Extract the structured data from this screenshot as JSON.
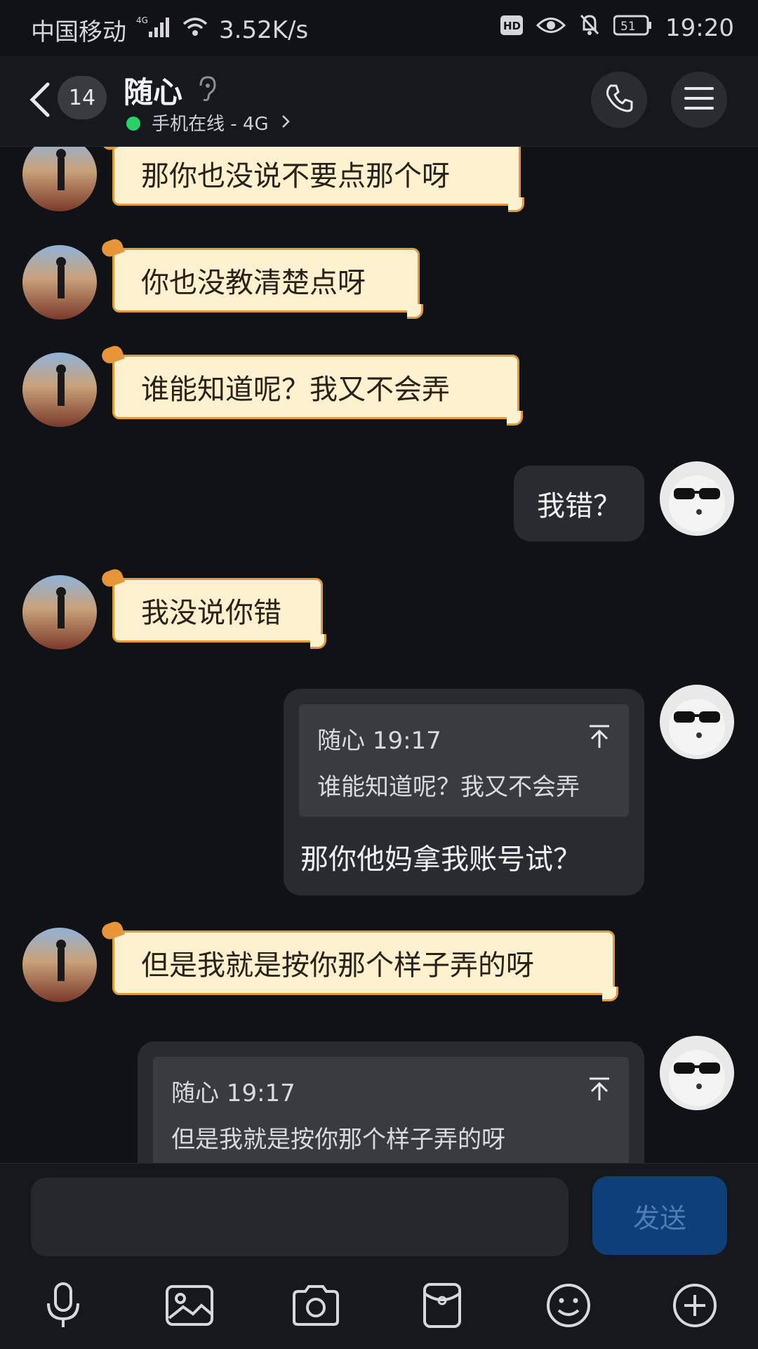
{
  "status": {
    "carrier": "中国移动",
    "net_speed": "3.52K/s",
    "network_tag": "4G",
    "hd": "HD",
    "battery": "51",
    "time": "19:20"
  },
  "header": {
    "unread_count": "14",
    "contact_name": "随心",
    "online_status": "手机在线 - 4G"
  },
  "messages": [
    {
      "side": "left",
      "text": "那你也没说不要点那个呀"
    },
    {
      "side": "left",
      "text": "你也没教清楚点呀"
    },
    {
      "side": "left",
      "text": "谁能知道呢？我又不会弄"
    },
    {
      "side": "right",
      "text": "我错？"
    },
    {
      "side": "left",
      "text": "我没说你错"
    },
    {
      "side": "right",
      "quote_meta": "随心 19:17",
      "quote_text": "谁能知道呢？我又不会弄",
      "text": "那你他妈拿我账号试？"
    },
    {
      "side": "left",
      "text": "但是我就是按你那个样子弄的呀"
    },
    {
      "side": "right",
      "quote_meta": "随心 19:17",
      "quote_text": "但是我就是按你那个样子弄的呀"
    }
  ],
  "input": {
    "send_label": "发送"
  },
  "colors": {
    "background": "#111216",
    "cat_bubble": "#fdf1cf",
    "cat_border": "#e09a3a",
    "my_bubble": "#2a2b30",
    "send_button": "#0f3f78",
    "online_dot": "#2ad06a"
  },
  "icons": [
    "back-icon",
    "ear-icon",
    "phone-icon",
    "menu-icon",
    "microphone-icon",
    "image-icon",
    "camera-icon",
    "red-packet-icon",
    "emoji-icon",
    "plus-icon"
  ]
}
